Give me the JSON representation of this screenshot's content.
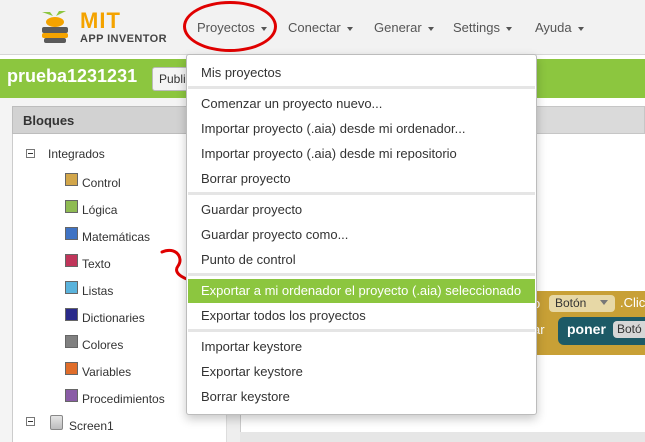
{
  "logo": {
    "brand": "MIT",
    "product": "APP INVENTOR"
  },
  "nav": [
    {
      "label": "Proyectos"
    },
    {
      "label": "Conectar"
    },
    {
      "label": "Generar"
    },
    {
      "label": "Settings"
    },
    {
      "label": "Ayuda"
    }
  ],
  "project": {
    "name": "prueba1231231",
    "publish_label": "Publi"
  },
  "blocks_panel": {
    "title": "Bloques",
    "root_label": "Integrados",
    "categories": [
      {
        "label": "Control",
        "color": "#d2a64a"
      },
      {
        "label": "Lógica",
        "color": "#8fbb53"
      },
      {
        "label": "Matemáticas",
        "color": "#3f73c4"
      },
      {
        "label": "Texto",
        "color": "#c0355a"
      },
      {
        "label": "Listas",
        "color": "#5ab3dc"
      },
      {
        "label": "Dictionaries",
        "color": "#2a2a8a"
      },
      {
        "label": "Colores",
        "color": "#808080"
      },
      {
        "label": "Variables",
        "color": "#e06d2a"
      },
      {
        "label": "Procedimientos",
        "color": "#8a5ca6"
      }
    ],
    "screen_label": "Screen1"
  },
  "workspace": {
    "event_fragment_top": "o",
    "event_fragment_bottom": "ar",
    "component_chip": "Botón",
    "click_fragment": ".Clic",
    "setter_label": "poner",
    "setter_component": "Botó"
  },
  "menu": {
    "items": [
      "Mis proyectos",
      "Comenzar un proyecto nuevo...",
      "Importar proyecto (.aia) desde mi ordenador...",
      "Importar proyecto (.aia) desde mi repositorio",
      "Borrar proyecto",
      "Guardar proyecto",
      "Guardar proyecto como...",
      "Punto de control",
      "Exportar a mi ordenador el proyecto (.aia) seleccionado",
      "Exportar todos los proyectos",
      "Importar keystore",
      "Exportar keystore",
      "Borrar keystore"
    ],
    "highlighted_index": 8
  },
  "colors": {
    "accent_green": "#8cc63f",
    "annotation_red": "#e00000",
    "logo_orange": "#f4a300"
  }
}
